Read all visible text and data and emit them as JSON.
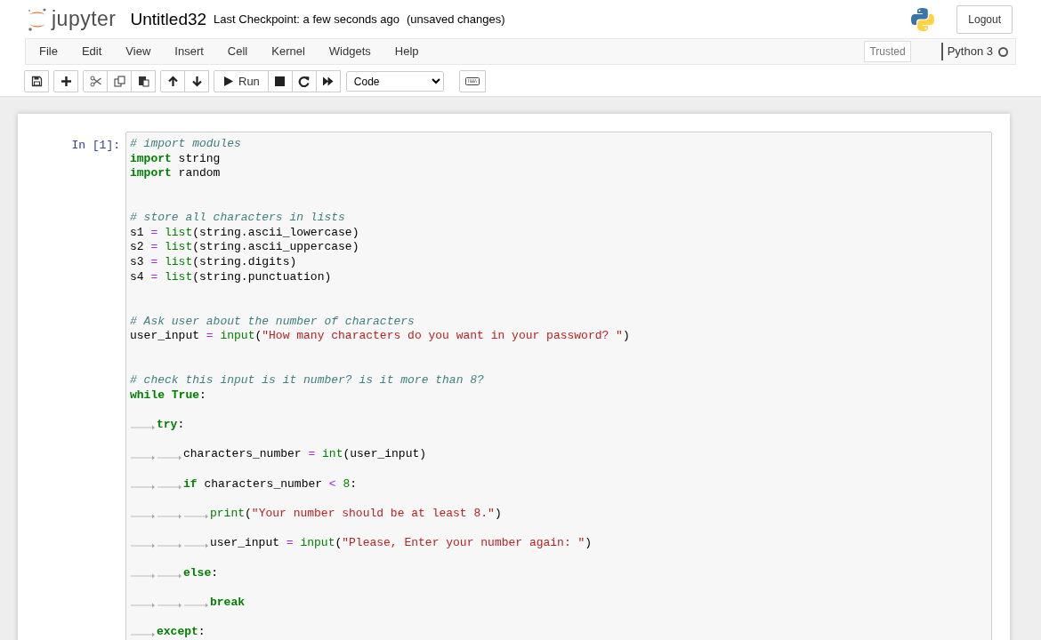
{
  "header": {
    "logo_text": "jupyter",
    "notebook_name": "Untitled32",
    "checkpoint": "Last Checkpoint: a few seconds ago",
    "autosave_status": "(unsaved changes)",
    "logout": "Logout"
  },
  "menu": [
    "File",
    "Edit",
    "View",
    "Insert",
    "Cell",
    "Kernel",
    "Widgets",
    "Help"
  ],
  "trusted": "Trusted",
  "kernel": {
    "name": "Python 3",
    "busy": false
  },
  "toolbar": [
    [
      {
        "kind": "save"
      }
    ],
    [
      {
        "kind": "insert"
      }
    ],
    [
      {
        "kind": "cut"
      },
      {
        "kind": "copy"
      },
      {
        "kind": "paste"
      }
    ],
    [
      {
        "kind": "up"
      },
      {
        "kind": "down"
      }
    ],
    [
      {
        "kind": "run",
        "label": "Run"
      },
      {
        "kind": "stop"
      },
      {
        "kind": "restart"
      },
      {
        "kind": "run-all"
      }
    ],
    [
      {
        "kind": "cell-type",
        "value": "Code"
      }
    ],
    [
      {
        "kind": "keyboard"
      }
    ]
  ],
  "cell": {
    "prompt": "In [1]:",
    "lines": [
      {
        "kind": "code",
        "tokens": [
          {
            "kind": "comment",
            "text": "# import modules"
          }
        ]
      },
      {
        "kind": "code",
        "tokens": [
          {
            "kind": "keyword",
            "text": "import"
          },
          {
            "kind": "plain",
            "text": " string"
          }
        ]
      },
      {
        "kind": "code",
        "tokens": [
          {
            "kind": "keyword",
            "text": "import"
          },
          {
            "kind": "plain",
            "text": " random"
          }
        ]
      },
      {
        "kind": "blank"
      },
      {
        "kind": "blank"
      },
      {
        "kind": "code",
        "tokens": [
          {
            "kind": "comment",
            "text": "# store all characters in lists"
          }
        ]
      },
      {
        "kind": "code",
        "tokens": [
          {
            "kind": "plain",
            "text": "s1"
          },
          {
            "kind": "operator",
            "text": " = "
          },
          {
            "kind": "builtin",
            "text": "list"
          },
          {
            "kind": "plain",
            "text": "(string.ascii_lowercase)"
          }
        ]
      },
      {
        "kind": "code",
        "tokens": [
          {
            "kind": "plain",
            "text": "s2"
          },
          {
            "kind": "operator",
            "text": " = "
          },
          {
            "kind": "builtin",
            "text": "list"
          },
          {
            "kind": "plain",
            "text": "(string.ascii_uppercase)"
          }
        ]
      },
      {
        "kind": "code",
        "tokens": [
          {
            "kind": "plain",
            "text": "s3"
          },
          {
            "kind": "operator",
            "text": " = "
          },
          {
            "kind": "builtin",
            "text": "list"
          },
          {
            "kind": "plain",
            "text": "(string.digits)"
          }
        ]
      },
      {
        "kind": "code",
        "tokens": [
          {
            "kind": "plain",
            "text": "s4"
          },
          {
            "kind": "operator",
            "text": " = "
          },
          {
            "kind": "builtin",
            "text": "list"
          },
          {
            "kind": "plain",
            "text": "(string.punctuation)"
          }
        ]
      },
      {
        "kind": "blank"
      },
      {
        "kind": "blank"
      },
      {
        "kind": "code",
        "tokens": [
          {
            "kind": "comment",
            "text": "# Ask user about the number of characters"
          }
        ]
      },
      {
        "kind": "code",
        "tokens": [
          {
            "kind": "plain",
            "text": "user_input"
          },
          {
            "kind": "operator",
            "text": " = "
          },
          {
            "kind": "builtin",
            "text": "input"
          },
          {
            "kind": "plain",
            "text": "("
          },
          {
            "kind": "string",
            "text": "\"How many characters do you want in your password? \""
          },
          {
            "kind": "plain",
            "text": ")"
          }
        ]
      },
      {
        "kind": "blank"
      },
      {
        "kind": "blank"
      },
      {
        "kind": "code",
        "tokens": [
          {
            "kind": "comment",
            "text": "# check this input is it number? is it more than 8?"
          }
        ]
      },
      {
        "kind": "code",
        "tokens": [
          {
            "kind": "keyword",
            "text": "while"
          },
          {
            "kind": "keyword",
            "text": " True"
          },
          {
            "kind": "plain",
            "text": ":"
          }
        ]
      },
      {
        "kind": "blank"
      },
      {
        "kind": "code",
        "tokens": [
          {
            "kind": "tab"
          },
          {
            "kind": "keyword",
            "text": "try"
          },
          {
            "kind": "plain",
            "text": ":"
          }
        ]
      },
      {
        "kind": "blank"
      },
      {
        "kind": "code",
        "tokens": [
          {
            "kind": "tab"
          },
          {
            "kind": "tab"
          },
          {
            "kind": "plain",
            "text": "characters_number"
          },
          {
            "kind": "operator",
            "text": " = "
          },
          {
            "kind": "builtin",
            "text": "int"
          },
          {
            "kind": "plain",
            "text": "(user_input)"
          }
        ]
      },
      {
        "kind": "blank"
      },
      {
        "kind": "code",
        "tokens": [
          {
            "kind": "tab"
          },
          {
            "kind": "tab"
          },
          {
            "kind": "keyword",
            "text": "if"
          },
          {
            "kind": "plain",
            "text": " characters_number"
          },
          {
            "kind": "operator",
            "text": " < "
          },
          {
            "kind": "number",
            "text": "8"
          },
          {
            "kind": "plain",
            "text": ":"
          }
        ]
      },
      {
        "kind": "blank"
      },
      {
        "kind": "code",
        "tokens": [
          {
            "kind": "tab"
          },
          {
            "kind": "tab"
          },
          {
            "kind": "tab"
          },
          {
            "kind": "builtin",
            "text": "print"
          },
          {
            "kind": "plain",
            "text": "("
          },
          {
            "kind": "string",
            "text": "\"Your number should be at least 8.\""
          },
          {
            "kind": "plain",
            "text": ")"
          }
        ]
      },
      {
        "kind": "blank"
      },
      {
        "kind": "code",
        "tokens": [
          {
            "kind": "tab"
          },
          {
            "kind": "tab"
          },
          {
            "kind": "tab"
          },
          {
            "kind": "plain",
            "text": "user_input"
          },
          {
            "kind": "operator",
            "text": " = "
          },
          {
            "kind": "builtin",
            "text": "input"
          },
          {
            "kind": "plain",
            "text": "("
          },
          {
            "kind": "string",
            "text": "\"Please, Enter your number again: \""
          },
          {
            "kind": "plain",
            "text": ")"
          }
        ]
      },
      {
        "kind": "blank"
      },
      {
        "kind": "code",
        "tokens": [
          {
            "kind": "tab"
          },
          {
            "kind": "tab"
          },
          {
            "kind": "keyword",
            "text": "else"
          },
          {
            "kind": "plain",
            "text": ":"
          }
        ]
      },
      {
        "kind": "blank"
      },
      {
        "kind": "code",
        "tokens": [
          {
            "kind": "tab"
          },
          {
            "kind": "tab"
          },
          {
            "kind": "tab"
          },
          {
            "kind": "keyword",
            "text": "break"
          }
        ]
      },
      {
        "kind": "blank"
      },
      {
        "kind": "code",
        "tokens": [
          {
            "kind": "tab"
          },
          {
            "kind": "keyword",
            "text": "except"
          },
          {
            "kind": "plain",
            "text": ":"
          }
        ]
      }
    ]
  }
}
